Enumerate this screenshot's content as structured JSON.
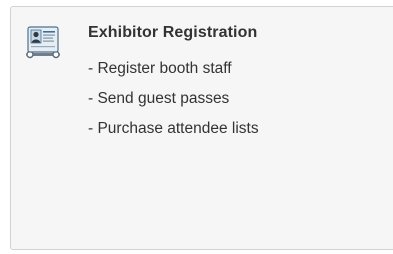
{
  "card": {
    "title": "Exhibitor Registration",
    "icon": "badge-icon",
    "items": [
      {
        "label": "- Register booth staff"
      },
      {
        "label": "- Send guest passes"
      },
      {
        "label": "- Purchase attendee lists"
      }
    ]
  },
  "colors": {
    "card_background": "#f6f6f6",
    "card_border": "#d2d2d2",
    "text": "#333333",
    "icon_accent": "#3e6f9a"
  }
}
